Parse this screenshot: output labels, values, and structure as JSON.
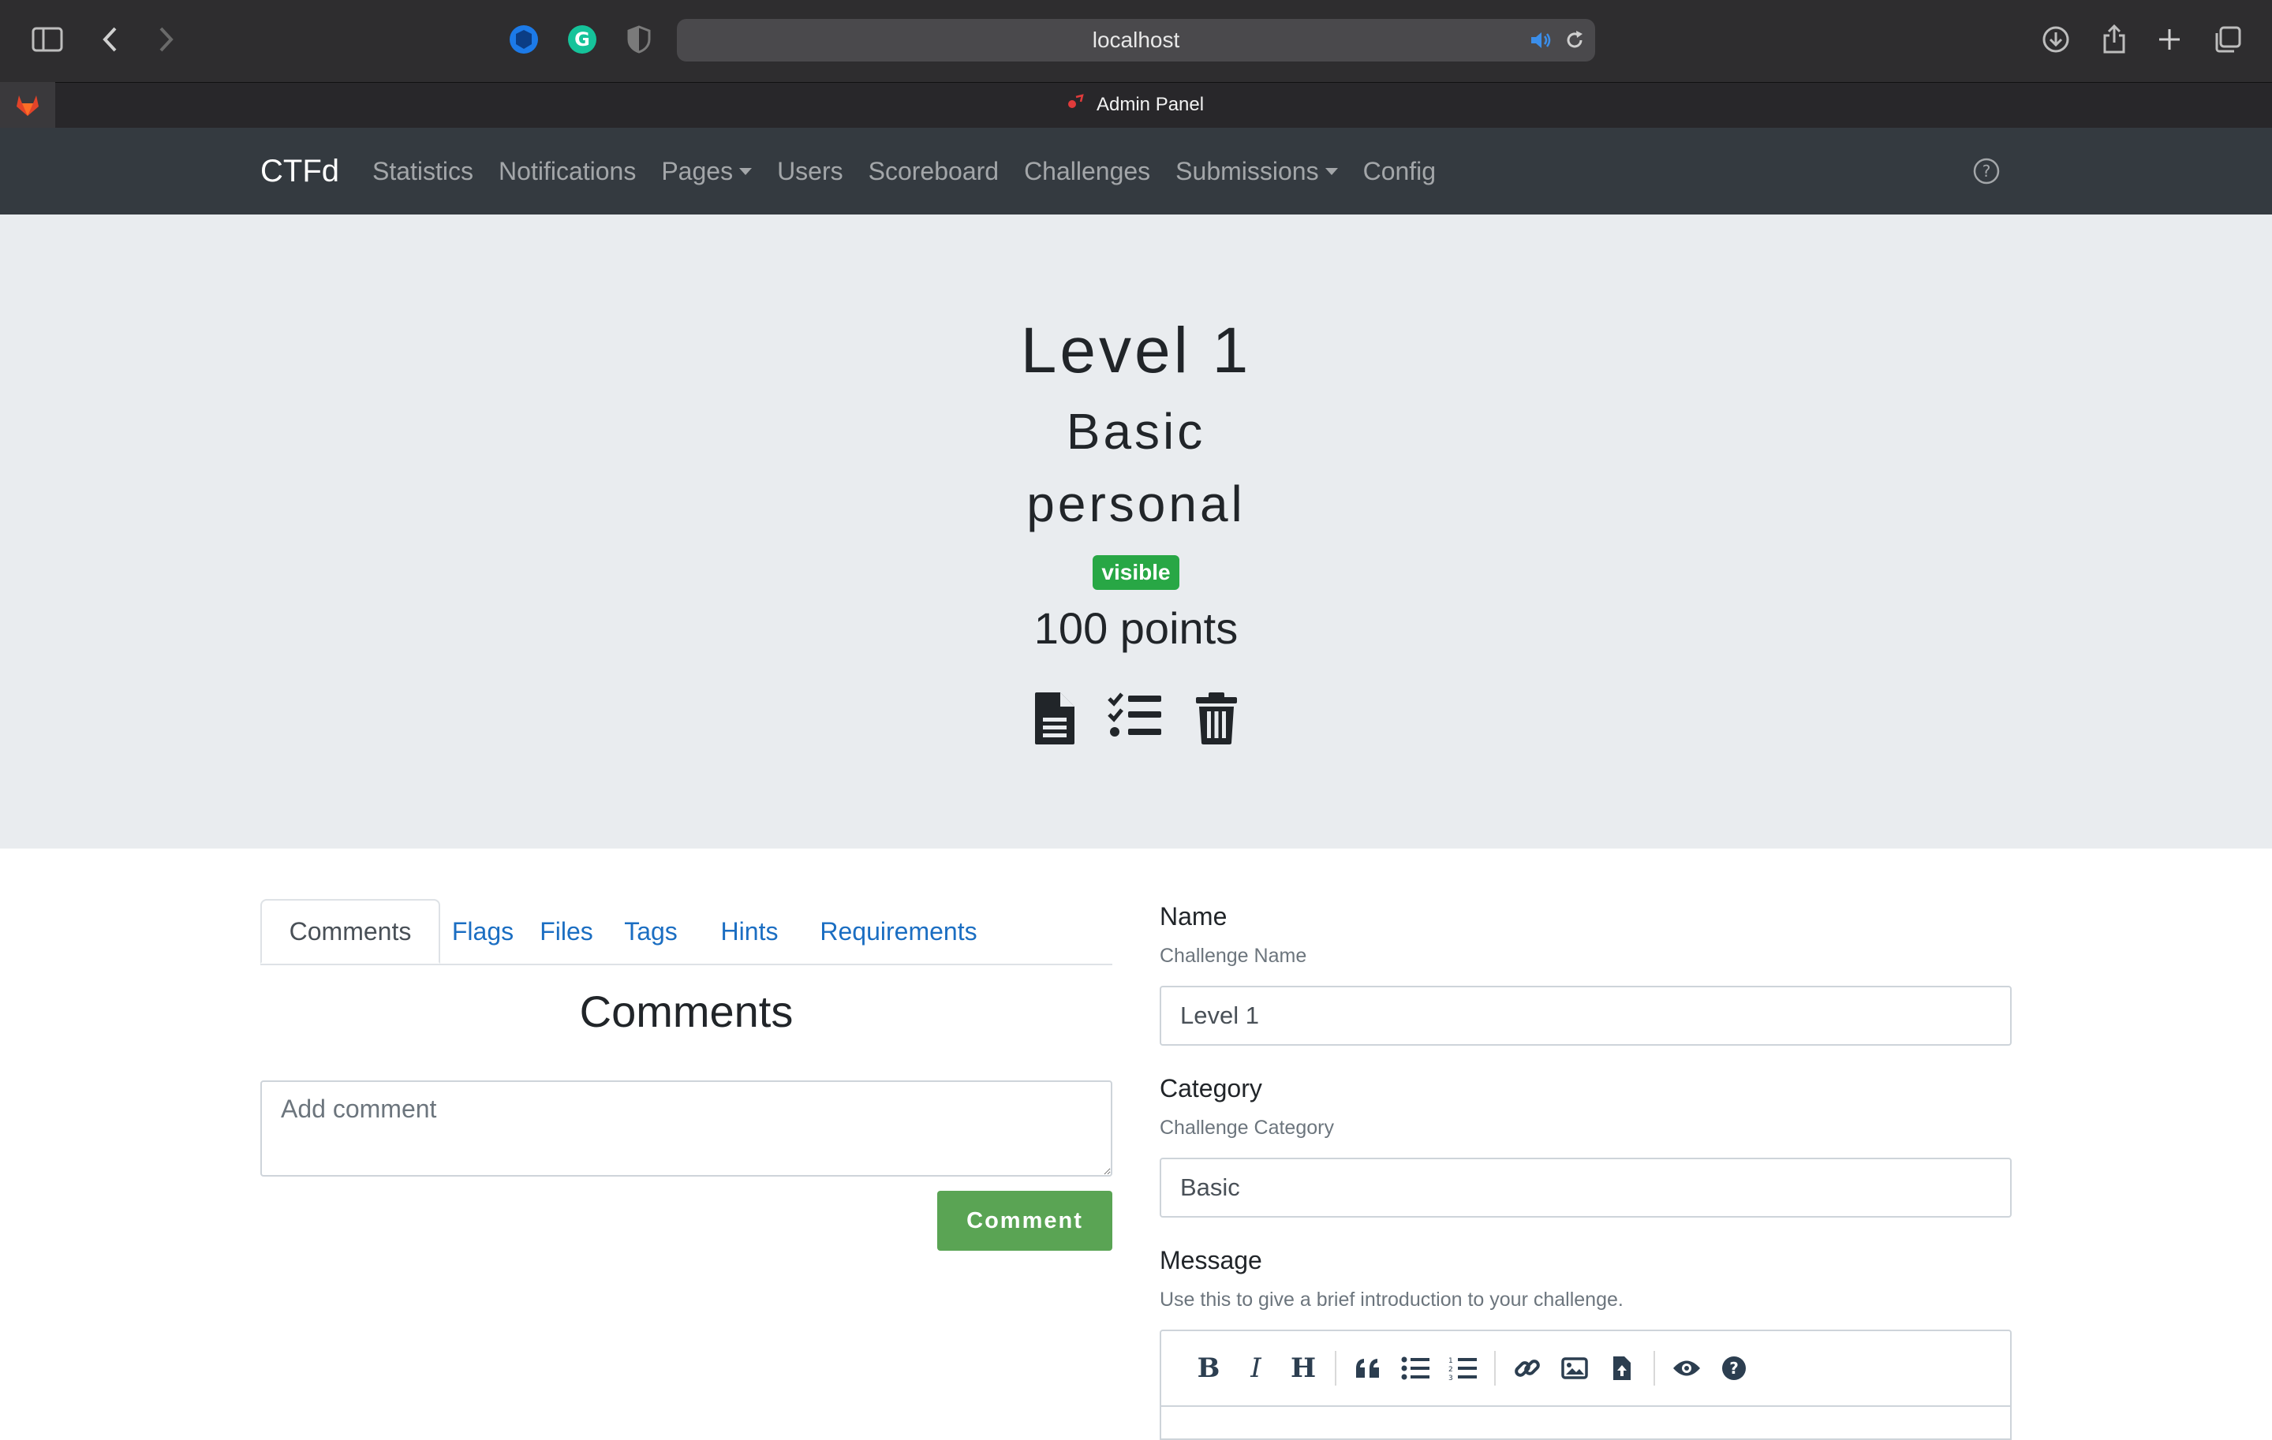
{
  "browser": {
    "url": "localhost",
    "tab_title": "Admin Panel"
  },
  "navbar": {
    "brand": "CTFd",
    "items": [
      {
        "label": "Statistics"
      },
      {
        "label": "Notifications"
      },
      {
        "label": "Pages"
      },
      {
        "label": "Users"
      },
      {
        "label": "Scoreboard"
      },
      {
        "label": "Challenges"
      },
      {
        "label": "Submissions"
      },
      {
        "label": "Config"
      }
    ]
  },
  "challenge": {
    "name": "Level 1",
    "category": "Basic",
    "type": "personal",
    "state": "visible",
    "points": "100 points"
  },
  "tabs": [
    {
      "label": "Comments"
    },
    {
      "label": "Flags"
    },
    {
      "label": "Files"
    },
    {
      "label": "Tags"
    },
    {
      "label": "Hints"
    },
    {
      "label": "Requirements"
    }
  ],
  "comments": {
    "heading": "Comments",
    "placeholder": "Add comment",
    "button": "Comment"
  },
  "form": {
    "name_label": "Name",
    "name_help": "Challenge Name",
    "name_value": "Level 1",
    "category_label": "Category",
    "category_help": "Challenge Category",
    "category_value": "Basic",
    "message_label": "Message",
    "message_help": "Use this to give a brief introduction to your challenge."
  },
  "colors": {
    "navbar_bg": "#343a40",
    "jumbotron_bg": "#e9ecef",
    "badge_success": "#28a745",
    "comment_button": "#5aa454",
    "link": "#1b6ec2"
  },
  "icons": {
    "actions": [
      "file-text-icon",
      "tasks-list-icon",
      "trash-icon"
    ],
    "editor_toolbar": [
      "bold-icon",
      "italic-icon",
      "heading-icon",
      "quote-icon",
      "unordered-list-icon",
      "ordered-list-icon",
      "link-icon",
      "image-icon",
      "upload-file-icon",
      "preview-icon",
      "guide-icon"
    ]
  }
}
